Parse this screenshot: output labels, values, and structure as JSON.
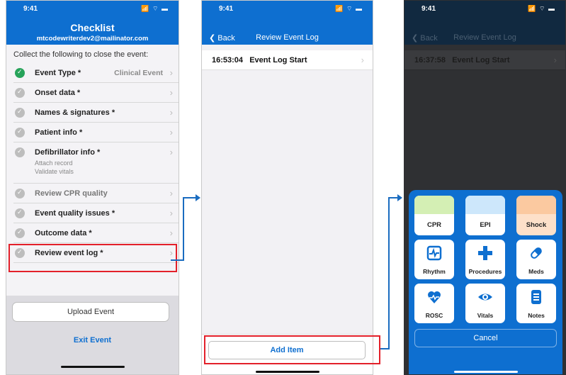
{
  "status": {
    "time": "9:41",
    "signal": "📶 ⌔ ▬"
  },
  "checklist_screen": {
    "title": "Checklist",
    "subtitle": "mtcodewriterdev2@mailinator.com",
    "intro": "Collect the following to close the event:",
    "items": [
      {
        "label": "Event Type *",
        "value": "Clinical Event",
        "done": true
      },
      {
        "label": "Onset data *"
      },
      {
        "label": "Names & signatures *"
      },
      {
        "label": "Patient info *"
      },
      {
        "label": "Defibrillator info *",
        "sub1": "Attach record",
        "sub2": "Validate vitals"
      },
      {
        "label": "Review CPR quality"
      },
      {
        "label": "Event quality issues *"
      },
      {
        "label": "Outcome data *"
      },
      {
        "label": "Review event log *"
      }
    ],
    "upload_label": "Upload Event",
    "exit_label": "Exit Event"
  },
  "log_screen": {
    "back": "Back",
    "title": "Review Event Log",
    "rows": [
      {
        "time": "16:53:04",
        "label": "Event Log Start"
      }
    ],
    "add_item_label": "Add Item"
  },
  "log_screen_modal": {
    "back": "Back",
    "title": "Review Event Log",
    "rows": [
      {
        "time": "16:37:58",
        "label": "Event Log Start"
      }
    ],
    "tiles": {
      "cpr": "CPR",
      "epi": "EPI",
      "shock": "Shock",
      "rhythm": "Rhythm",
      "procedures": "Procedures",
      "meds": "Meds",
      "rosc": "ROSC",
      "vitals": "Vitals",
      "notes": "Notes"
    },
    "cancel_label": "Cancel"
  },
  "colors": {
    "primary": "#0e6fd0",
    "highlight": "#e3202a",
    "done": "#27a35a",
    "cpr": "#d4efb4",
    "epi": "#cde7fb",
    "shock": "#fbc9a0"
  }
}
